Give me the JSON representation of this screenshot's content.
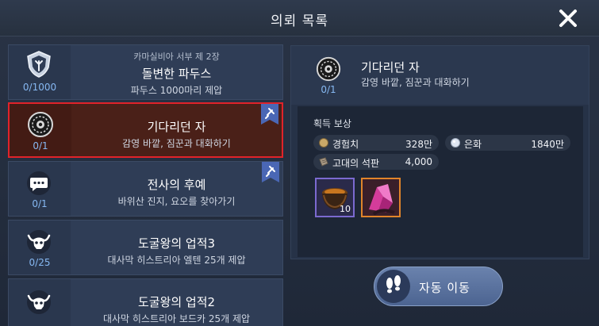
{
  "header": {
    "title": "의뢰 목록"
  },
  "quests": [
    {
      "chapter": "카마실비아 서부 제 2장",
      "name": "돌변한 파두스",
      "desc": "파두스 1000마리 제압",
      "count": "0/1000",
      "icon": "shield-sprout-icon"
    },
    {
      "name": "기다리던 자",
      "desc": "감영 바깥, 짐꾼과 대화하기",
      "count": "0/1",
      "icon": "gear-emblem-icon",
      "pinned": true,
      "selected": true
    },
    {
      "name": "전사의 후예",
      "desc": "바위산 진지, 요오를 찾아가기",
      "count": "0/1",
      "icon": "chat-icon",
      "pinned": true
    },
    {
      "name": "도굴왕의 업적3",
      "desc": "대사막 히스트리아 엘텐 25개 제압",
      "count": "0/25",
      "icon": "horned-skull-icon"
    },
    {
      "name": "도굴왕의 업적2",
      "desc": "대사막 히스트리아 보드카 25개 제압",
      "count": "",
      "icon": "horned-skull-icon"
    }
  ],
  "detail": {
    "name": "기다리던 자",
    "desc": "감영 바깥, 짐꾼과 대화하기",
    "count": "0/1",
    "rewards_title": "획득 보상",
    "rewards": [
      {
        "icon": "experience-orb-icon",
        "label": "경험치",
        "value": "328만"
      },
      {
        "icon": "silver-coin-icon",
        "label": "은화",
        "value": "1840만"
      },
      {
        "icon": "stone-tablet-icon",
        "label": "고대의 석판",
        "value": "4,000"
      }
    ],
    "items": [
      {
        "icon": "soup-bowl-icon",
        "qty": "10",
        "border": "#7b6ad0"
      },
      {
        "icon": "pink-crystal-icon",
        "qty": "",
        "border": "#e0842a"
      }
    ]
  },
  "auto_button": {
    "label": "자동 이동",
    "icon": "footprints-icon"
  },
  "colors": {
    "selected_border": "#e0232a",
    "count_text": "#86b8f2",
    "pin_badge": "#4a67b5"
  }
}
